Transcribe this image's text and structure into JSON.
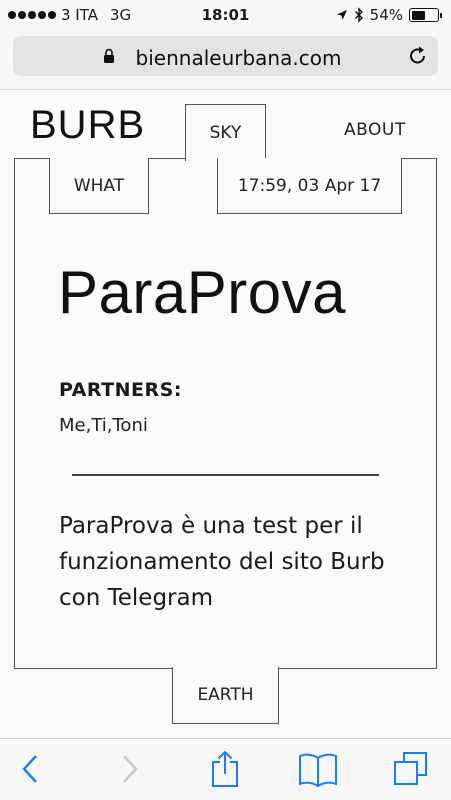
{
  "status_bar": {
    "carrier": "3 ITA",
    "network": "3G",
    "time": "18:01",
    "battery": "54%",
    "battery_level": 0.54
  },
  "browser": {
    "url": "biennaleurbana.com"
  },
  "header": {
    "logo": "BURB",
    "sky_tab": "SKY",
    "about_link": "ABOUT"
  },
  "card": {
    "what_tab": "WHAT",
    "datetime": "17:59, 03 Apr 17",
    "title": "ParaProva",
    "partners_label": "PARTNERS:",
    "partners_value": "Me,Ti,Toni",
    "description": "ParaProva è una test per il funzionamento del sito Burb con Telegram"
  },
  "footer": {
    "earth_tab": "EARTH"
  },
  "colors": {
    "accent": "#1a7cf5",
    "text": "#1a1a1a",
    "border": "#555555"
  },
  "toolbar": {
    "icons": [
      "back-icon",
      "forward-icon",
      "share-icon",
      "bookmarks-icon",
      "tabs-icon"
    ]
  }
}
